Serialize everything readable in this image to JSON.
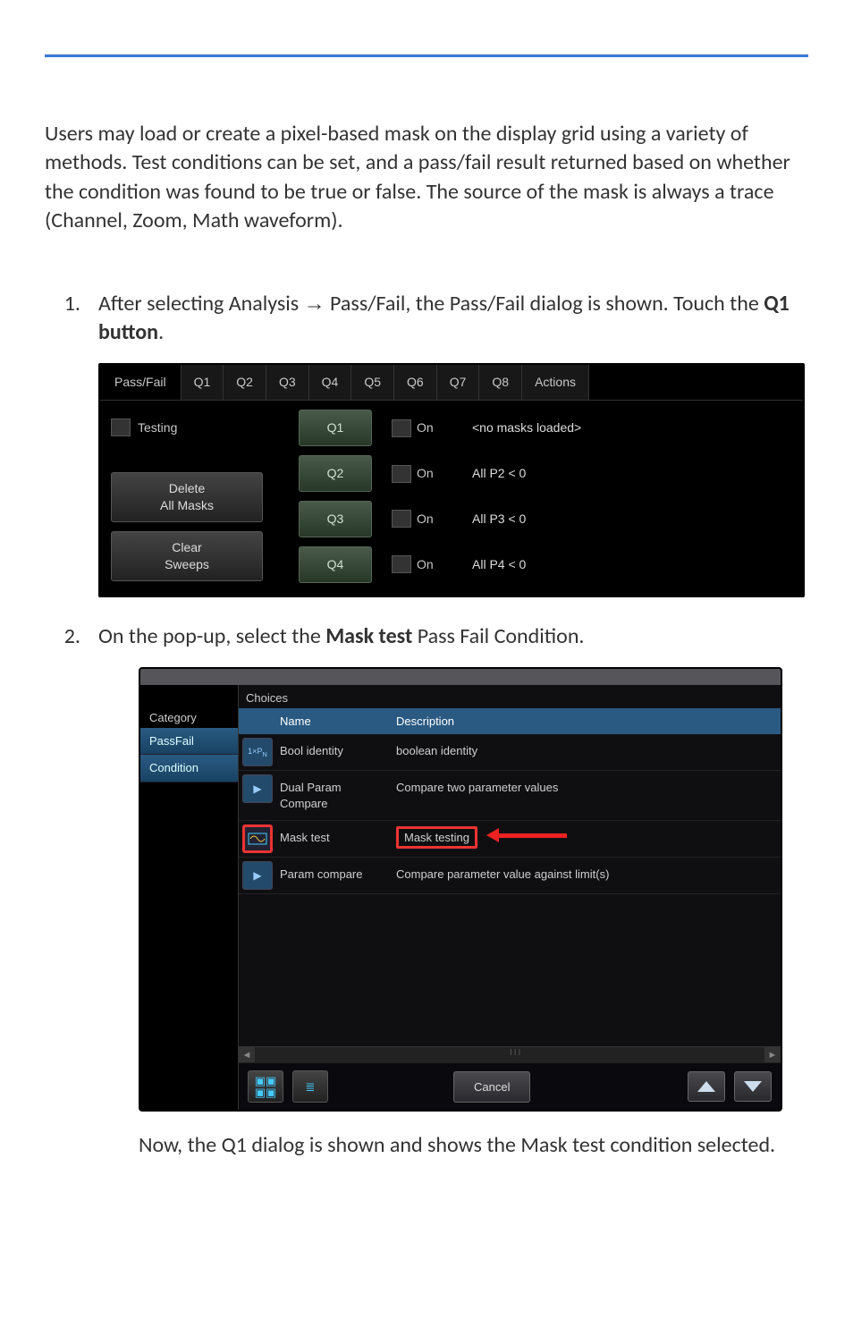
{
  "intro": "Users may load or create a pixel-based mask on the display grid using a variety of methods. Test conditions can be set, and a pass/fail result returned based on whether the condition was found to be true or false. The source of the mask is always a trace (Channel, Zoom, Math waveform).",
  "step1": {
    "num": "1.",
    "text_pre": "After selecting Analysis ",
    "arrow": "→",
    "text_mid": " Pass/Fail, the Pass/Fail dialog is shown. Touch the ",
    "bold": "Q1 button",
    "text_post": "."
  },
  "dialog1": {
    "tabs": [
      "Pass/Fail",
      "Q1",
      "Q2",
      "Q3",
      "Q4",
      "Q5",
      "Q6",
      "Q7",
      "Q8",
      "Actions"
    ],
    "testing_label": "Testing",
    "delete_btn": "Delete\nAll Masks",
    "clear_btn": "Clear\nSweeps",
    "rows": [
      {
        "q": "Q1",
        "on": "On",
        "status": "<no masks loaded>"
      },
      {
        "q": "Q2",
        "on": "On",
        "status": "All P2 < 0"
      },
      {
        "q": "Q3",
        "on": "On",
        "status": "All P3 < 0"
      },
      {
        "q": "Q4",
        "on": "On",
        "status": "All P4 < 0"
      }
    ]
  },
  "step2": {
    "num": "2.",
    "text_pre": "On the pop-up, select the ",
    "bold": "Mask test",
    "text_post": " Pass Fail Condition."
  },
  "dialog2": {
    "category_hdr": "Category",
    "choices_hdr": "Choices",
    "side": {
      "passfail": "PassFail",
      "condition": "Condition"
    },
    "cols": {
      "name": "Name",
      "desc": "Description"
    },
    "rows": [
      {
        "icon": "1xP",
        "name": "Bool identity",
        "desc": "boolean identity"
      },
      {
        "icon": "P>Q",
        "name": "Dual Param Compare",
        "desc": "Compare two parameter values"
      },
      {
        "icon": "eye",
        "name": "Mask test",
        "desc": "Mask testing",
        "selected": true
      },
      {
        "icon": "P>Q",
        "name": "Param compare",
        "desc": "Compare parameter value against limit(s)"
      }
    ],
    "cancel": "Cancel"
  },
  "result": "Now, the Q1 dialog is shown and shows the Mask test condition selected."
}
